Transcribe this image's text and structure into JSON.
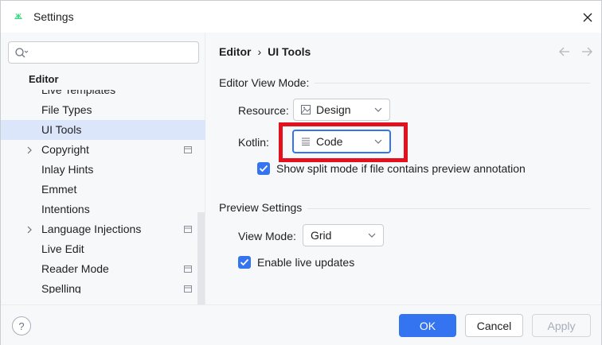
{
  "window": {
    "title": "Settings"
  },
  "search": {
    "value": "",
    "placeholder": ""
  },
  "sidebar": {
    "group": "Editor",
    "items": [
      {
        "label": "Live Templates",
        "selected": false,
        "expandable": false,
        "badge": false
      },
      {
        "label": "File Types",
        "selected": false,
        "expandable": false,
        "badge": false
      },
      {
        "label": "UI Tools",
        "selected": true,
        "expandable": false,
        "badge": false
      },
      {
        "label": "Copyright",
        "selected": false,
        "expandable": true,
        "badge": true
      },
      {
        "label": "Inlay Hints",
        "selected": false,
        "expandable": false,
        "badge": false
      },
      {
        "label": "Emmet",
        "selected": false,
        "expandable": false,
        "badge": false
      },
      {
        "label": "Intentions",
        "selected": false,
        "expandable": false,
        "badge": false
      },
      {
        "label": "Language Injections",
        "selected": false,
        "expandable": true,
        "badge": true
      },
      {
        "label": "Live Edit",
        "selected": false,
        "expandable": false,
        "badge": false
      },
      {
        "label": "Reader Mode",
        "selected": false,
        "expandable": false,
        "badge": true
      },
      {
        "label": "Spelling",
        "selected": false,
        "expandable": false,
        "badge": true
      }
    ]
  },
  "breadcrumb": {
    "parent": "Editor",
    "separator": "›",
    "current": "UI Tools"
  },
  "editor_view_mode": {
    "title": "Editor View Mode:",
    "resource_label": "Resource:",
    "resource_value": "Design",
    "kotlin_label": "Kotlin:",
    "kotlin_value": "Code",
    "split_mode_label": "Show split mode if file contains preview annotation",
    "split_mode_checked": true
  },
  "preview_settings": {
    "title": "Preview Settings",
    "view_mode_label": "View Mode:",
    "view_mode_value": "Grid",
    "live_updates_label": "Enable live updates",
    "live_updates_checked": true
  },
  "footer": {
    "help_label": "?",
    "ok_label": "OK",
    "cancel_label": "Cancel",
    "apply_label": "Apply"
  },
  "colors": {
    "accent": "#3574f0",
    "selection": "#dbe6fb",
    "highlight": "#e3101e"
  }
}
